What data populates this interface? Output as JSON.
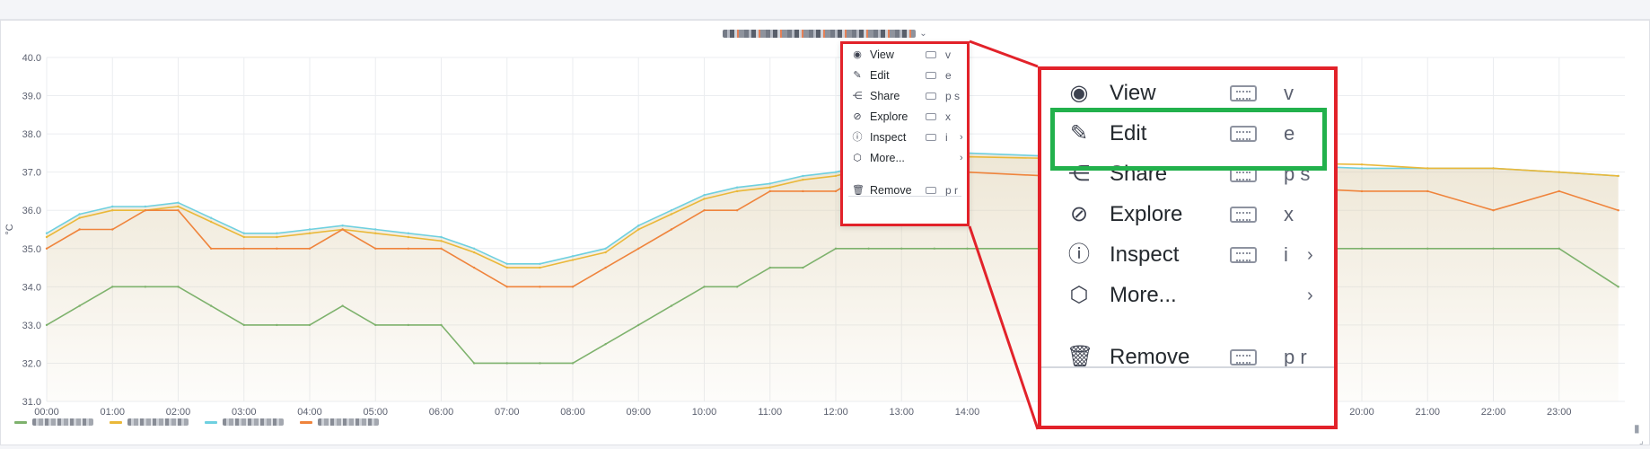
{
  "colors": {
    "green_series": "#7eb26d",
    "yellow_series": "#eab839",
    "cyan_series": "#6ed0e0",
    "orange_series": "#ef843c",
    "annotation_red": "#e2222a",
    "annotation_green": "#22b14c"
  },
  "panel": {
    "title_chevron": "⌄"
  },
  "chart_data": {
    "type": "line",
    "y_unit": "°C",
    "ylim": [
      31.0,
      40.0
    ],
    "y_ticks": [
      "40.0",
      "39.0",
      "38.0",
      "37.0",
      "36.0",
      "35.0",
      "34.0",
      "33.0",
      "32.0",
      "31.0"
    ],
    "x_ticks": [
      "00:00",
      "01:00",
      "02:00",
      "03:00",
      "04:00",
      "05:00",
      "06:00",
      "07:00",
      "08:00",
      "09:00",
      "10:00",
      "11:00",
      "12:00",
      "13:00",
      "14:00",
      "20:00",
      "21:00",
      "22:00",
      "23:00"
    ],
    "x_hours": [
      0,
      1,
      2,
      3,
      4,
      5,
      6,
      7,
      8,
      9,
      10,
      11,
      12,
      13,
      14,
      20,
      21,
      22,
      23
    ],
    "grid": true,
    "legend_placement": "bottom-left",
    "series": [
      {
        "color_key": "cyan_series",
        "x": [
          0,
          0.5,
          1,
          1.5,
          2,
          2.5,
          3,
          3.5,
          4,
          4.5,
          5,
          5.5,
          6,
          6.5,
          7,
          7.5,
          8,
          8.5,
          9,
          9.5,
          10,
          10.5,
          11,
          11.5,
          12,
          12.5,
          13,
          13.5,
          14,
          20,
          21,
          22,
          23,
          23.9
        ],
        "values": [
          35.4,
          35.9,
          36.1,
          36.1,
          36.2,
          35.8,
          35.4,
          35.4,
          35.5,
          35.6,
          35.5,
          35.4,
          35.3,
          35.0,
          34.6,
          34.6,
          34.8,
          35.0,
          35.6,
          36.0,
          36.4,
          36.6,
          36.7,
          36.9,
          37.0,
          37.2,
          37.4,
          37.4,
          37.5,
          37.1,
          37.1,
          37.1,
          37.0,
          36.9
        ]
      },
      {
        "color_key": "yellow_series",
        "x": [
          0,
          0.5,
          1,
          1.5,
          2,
          2.5,
          3,
          3.5,
          4,
          4.5,
          5,
          5.5,
          6,
          6.5,
          7,
          7.5,
          8,
          8.5,
          9,
          9.5,
          10,
          10.5,
          11,
          11.5,
          12,
          12.5,
          13,
          13.5,
          14,
          20,
          21,
          22,
          23,
          23.9
        ],
        "values": [
          35.3,
          35.8,
          36.0,
          36.0,
          36.1,
          35.7,
          35.3,
          35.3,
          35.4,
          35.5,
          35.4,
          35.3,
          35.2,
          34.9,
          34.5,
          34.5,
          34.7,
          34.9,
          35.5,
          35.9,
          36.3,
          36.5,
          36.6,
          36.8,
          36.9,
          37.1,
          37.3,
          37.3,
          37.4,
          37.2,
          37.1,
          37.1,
          37.0,
          36.9
        ]
      },
      {
        "color_key": "orange_series",
        "x": [
          0,
          0.5,
          1,
          1.5,
          2,
          2.5,
          3,
          3.5,
          4,
          4.5,
          5,
          5.5,
          6,
          6.5,
          7,
          7.5,
          8,
          8.5,
          9,
          9.5,
          10,
          10.5,
          11,
          11.5,
          12,
          12.5,
          13,
          13.5,
          14,
          20,
          21,
          22,
          23,
          23.9
        ],
        "values": [
          35.0,
          35.5,
          35.5,
          36.0,
          36.0,
          35.0,
          35.0,
          35.0,
          35.0,
          35.5,
          35.0,
          35.0,
          35.0,
          34.5,
          34.0,
          34.0,
          34.0,
          34.5,
          35.0,
          35.5,
          36.0,
          36.0,
          36.5,
          36.5,
          36.5,
          37.0,
          37.0,
          37.0,
          37.0,
          36.5,
          36.5,
          36.0,
          36.5,
          36.0
        ]
      },
      {
        "color_key": "green_series",
        "x": [
          0,
          0.5,
          1,
          1.5,
          2,
          2.5,
          3,
          3.5,
          4,
          4.5,
          5,
          5.5,
          6,
          6.5,
          7,
          7.5,
          8,
          8.5,
          9,
          9.5,
          10,
          10.5,
          11,
          11.5,
          12,
          12.5,
          13,
          13.5,
          14,
          20,
          21,
          22,
          23,
          23.9
        ],
        "values": [
          33.0,
          33.5,
          34.0,
          34.0,
          34.0,
          33.5,
          33.0,
          33.0,
          33.0,
          33.5,
          33.0,
          33.0,
          33.0,
          32.0,
          32.0,
          32.0,
          32.0,
          32.5,
          33.0,
          33.5,
          34.0,
          34.0,
          34.5,
          34.5,
          35.0,
          35.0,
          35.0,
          35.0,
          35.0,
          35.0,
          35.0,
          35.0,
          35.0,
          34.0
        ]
      }
    ]
  },
  "legend": {
    "items": [
      {
        "color_key": "green_series"
      },
      {
        "color_key": "yellow_series"
      },
      {
        "color_key": "cyan_series"
      },
      {
        "color_key": "orange_series"
      }
    ]
  },
  "context_menu": {
    "items": [
      {
        "icon": "eye-icon",
        "glyph": "◉",
        "label": "View",
        "shortcut": "v",
        "submenu": false
      },
      {
        "icon": "edit-icon",
        "glyph": "✎",
        "label": "Edit",
        "shortcut": "e",
        "submenu": false
      },
      {
        "icon": "share-icon",
        "glyph": "⋲",
        "label": "Share",
        "shortcut": "p s",
        "submenu": false
      },
      {
        "icon": "compass-icon",
        "glyph": "⊘",
        "label": "Explore",
        "shortcut": "x",
        "submenu": false
      },
      {
        "icon": "info-icon",
        "glyph": "ⓘ",
        "label": "Inspect",
        "shortcut": "i",
        "submenu": true
      },
      {
        "icon": "cube-icon",
        "glyph": "⬡",
        "label": "More...",
        "shortcut": "",
        "submenu": true
      }
    ],
    "remove": {
      "icon": "trash-icon",
      "glyph": "🗑",
      "label": "Remove",
      "shortcut": "p r"
    },
    "submenu_glyph": "›"
  }
}
